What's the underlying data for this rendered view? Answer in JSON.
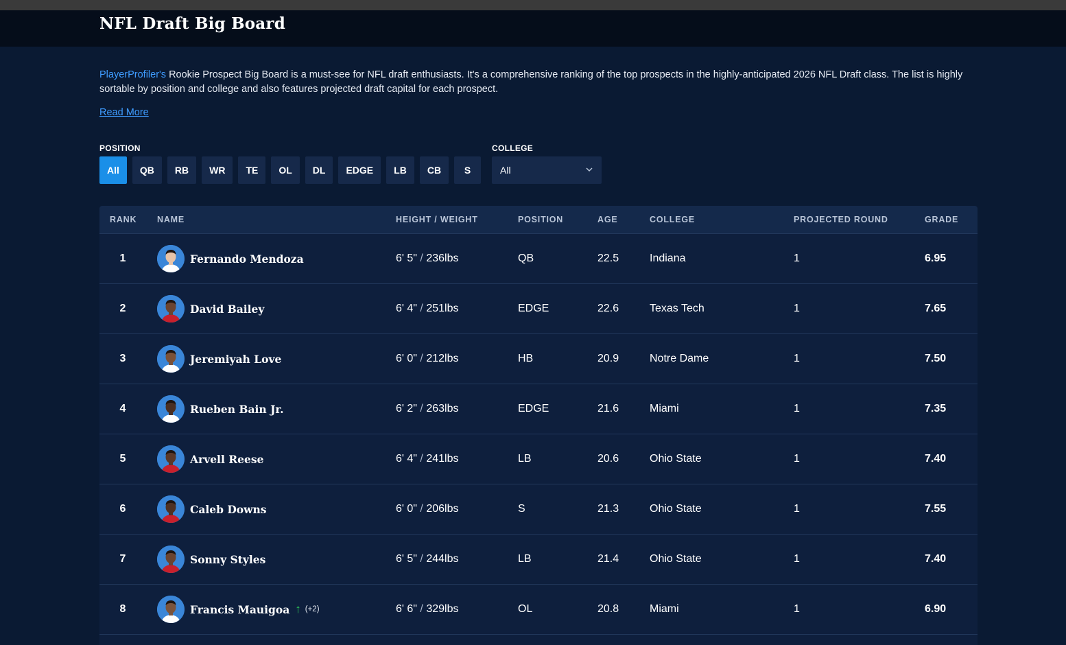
{
  "page": {
    "title": "NFL Draft Big Board",
    "intro_link": "PlayerProfiler's",
    "intro_text": " Rookie Prospect Big Board is a must-see for NFL draft enthusiasts. It's a comprehensive ranking of the top prospects in the highly-anticipated 2026 NFL Draft class. The list is highly sortable by position and college and also features projected draft capital for each prospect.",
    "read_more": "Read More"
  },
  "filters": {
    "position_label": "POSITION",
    "college_label": "COLLEGE",
    "positions": [
      "All",
      "QB",
      "RB",
      "WR",
      "TE",
      "OL",
      "DL",
      "EDGE",
      "LB",
      "CB",
      "S"
    ],
    "active_position": "All",
    "college_selected": "All"
  },
  "table": {
    "headers": {
      "rank": "RANK",
      "name": "NAME",
      "height_weight": "HEIGHT / WEIGHT",
      "position": "POSITION",
      "age": "AGE",
      "college": "COLLEGE",
      "projected_round": "PROJECTED ROUND",
      "grade": "GRADE"
    },
    "rows": [
      {
        "rank": "1",
        "name": "Fernando Mendoza",
        "height": "6' 5\"",
        "weight": "236lbs",
        "position": "QB",
        "age": "22.5",
        "college": "Indiana",
        "round": "1",
        "grade": "6.95",
        "skin": "#e8c4a8",
        "jersey": "#ffffff"
      },
      {
        "rank": "2",
        "name": "David Bailey",
        "height": "6' 4\"",
        "weight": "251lbs",
        "position": "EDGE",
        "age": "22.6",
        "college": "Texas Tech",
        "round": "1",
        "grade": "7.65",
        "skin": "#6b4430",
        "jersey": "#c8202c"
      },
      {
        "rank": "3",
        "name": "Jeremiyah Love",
        "height": "6' 0\"",
        "weight": "212lbs",
        "position": "HB",
        "age": "20.9",
        "college": "Notre Dame",
        "round": "1",
        "grade": "7.50",
        "skin": "#7a5138",
        "jersey": "#ffffff"
      },
      {
        "rank": "4",
        "name": "Rueben Bain Jr.",
        "height": "6' 2\"",
        "weight": "263lbs",
        "position": "EDGE",
        "age": "21.6",
        "college": "Miami",
        "round": "1",
        "grade": "7.35",
        "skin": "#4a2f22",
        "jersey": "#ffffff"
      },
      {
        "rank": "5",
        "name": "Arvell Reese",
        "height": "6' 4\"",
        "weight": "241lbs",
        "position": "LB",
        "age": "20.6",
        "college": "Ohio State",
        "round": "1",
        "grade": "7.40",
        "skin": "#5a3828",
        "jersey": "#c8202c"
      },
      {
        "rank": "6",
        "name": "Caleb Downs",
        "height": "6' 0\"",
        "weight": "206lbs",
        "position": "S",
        "age": "21.3",
        "college": "Ohio State",
        "round": "1",
        "grade": "7.55",
        "skin": "#4e3123",
        "jersey": "#c8202c"
      },
      {
        "rank": "7",
        "name": "Sonny Styles",
        "height": "6' 5\"",
        "weight": "244lbs",
        "position": "LB",
        "age": "21.4",
        "college": "Ohio State",
        "round": "1",
        "grade": "7.40",
        "skin": "#6a4431",
        "jersey": "#c8202c"
      },
      {
        "rank": "8",
        "name": "Francis Mauigoa",
        "height": "6' 6\"",
        "weight": "329lbs",
        "position": "OL",
        "age": "20.8",
        "college": "Miami",
        "round": "1",
        "grade": "6.90",
        "skin": "#7a543d",
        "jersey": "#ffffff",
        "trend": "↑",
        "trend_delta": "(+2)"
      }
    ]
  },
  "colors": {
    "background": "#0a1a33",
    "accent": "#1a8fe8",
    "link": "#3f9cff",
    "trend_up": "#2fd35a"
  }
}
